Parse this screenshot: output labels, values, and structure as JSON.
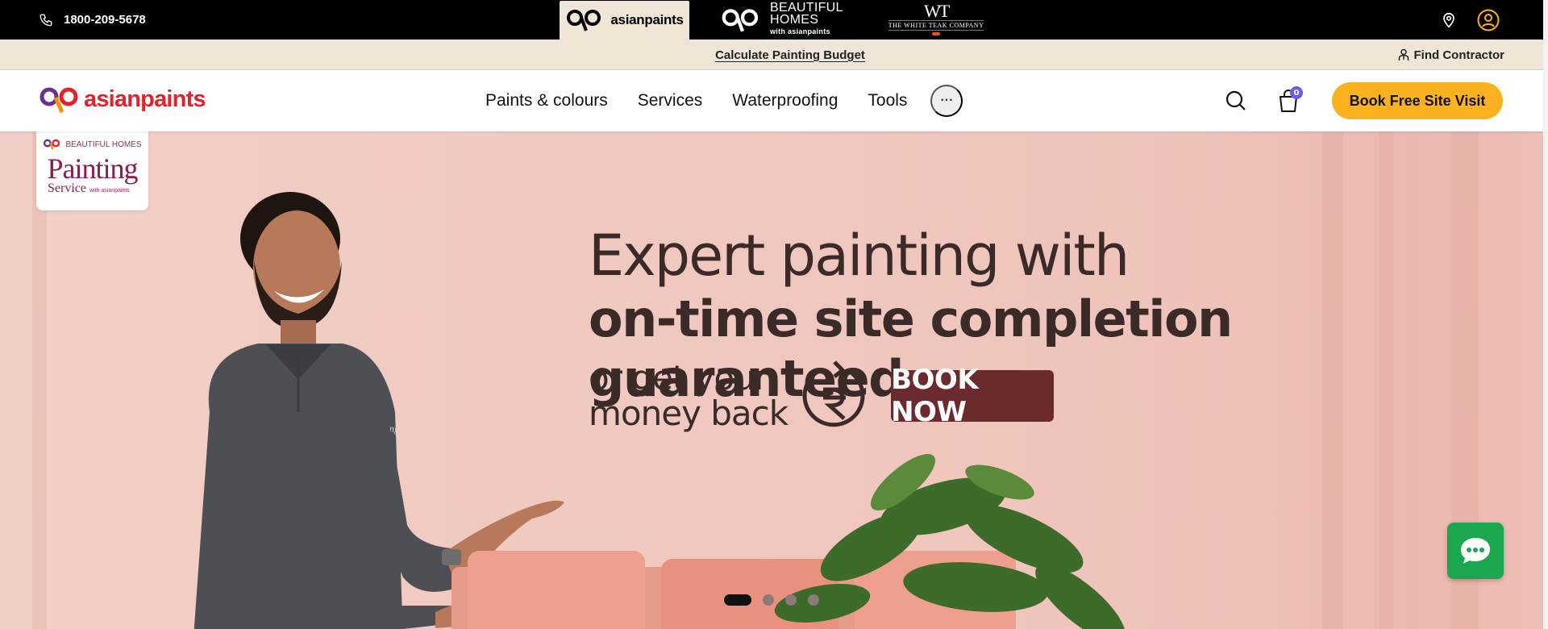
{
  "topbar": {
    "phone": "1800-209-5678",
    "brands": [
      {
        "name": "asianpaints",
        "active": true
      },
      {
        "line1": "BEAUTIFUL",
        "line2": "HOMES",
        "sub": "with asianpaints",
        "active": false
      },
      {
        "mark": "WT",
        "name": "THE WHITE TEAK COMPANY",
        "active": false
      }
    ],
    "icons": [
      "location-icon",
      "user-account-icon"
    ]
  },
  "subbar": {
    "budget_link": "Calculate Painting Budget",
    "find_contractor": "Find Contractor"
  },
  "nav": {
    "logo_text": "asianpaints",
    "links": [
      "Paints & colours",
      "Services",
      "Waterproofing",
      "Tools"
    ],
    "more_label": "···",
    "cart_count": "0",
    "cta": "Book Free Site Visit"
  },
  "hero": {
    "badge": {
      "brand": "BEAUTIFUL HOMES",
      "title": "Painting",
      "service": "Service",
      "sub": "with asianpaints"
    },
    "headline_1": "Expert painting with",
    "headline_2": "on-time site completion guaranteed",
    "money_line_1": "or get your",
    "money_line_2": "money back",
    "book_now": "BOOK NOW",
    "slides_total": 4,
    "slide_active": 1
  },
  "colors": {
    "accent_cta": "#fbb21e",
    "brand_red": "#e5222b",
    "hero_bg": "#f0c9c0",
    "book_now_bg": "#6b2a2e",
    "chat_green": "#1aa74d",
    "badge_purple": "#6e5ce6"
  }
}
